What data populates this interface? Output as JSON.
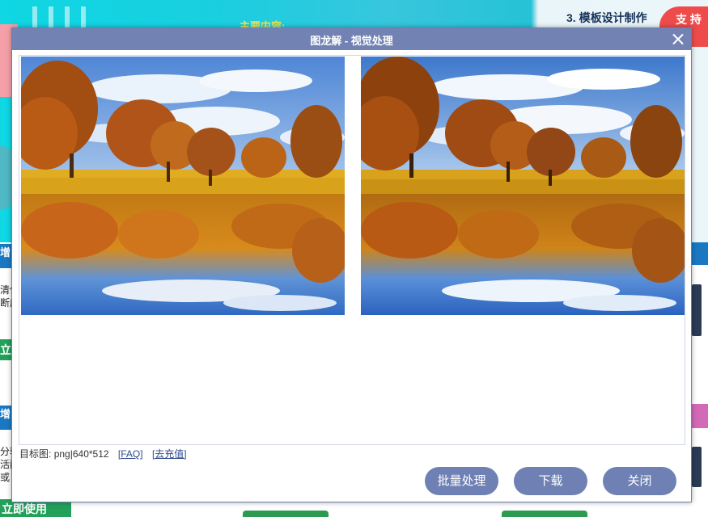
{
  "background": {
    "banner_text": "主要内容:",
    "right_title": "3. 模板设计制作",
    "badge_text": "支 持\n创",
    "left_bar_1": "增",
    "left_bar_2": "增",
    "left_snippet_1": "清体",
    "left_snippet_2": "断度",
    "left_snippet_3": "分转",
    "left_snippet_4": "活配",
    "left_snippet_5": "或",
    "green_button_1": "立",
    "green_button_bottom": "立即使用"
  },
  "dialog": {
    "title": "图龙解 - 视觉处理",
    "close_icon": "close-icon",
    "target_info_label": "目标图:",
    "target_format": "png",
    "target_separator": "|",
    "target_size": "640*512",
    "faq_link": "[FAQ]",
    "recharge_link": "[去充值]",
    "batch_button": "批量处理",
    "download_button": "下载",
    "close_button": "关闭",
    "colors": {
      "header": "#7283b3",
      "button": "#6f81b4"
    }
  },
  "images": {
    "original": "autumn-lake-original",
    "processed": "autumn-lake-processed"
  }
}
